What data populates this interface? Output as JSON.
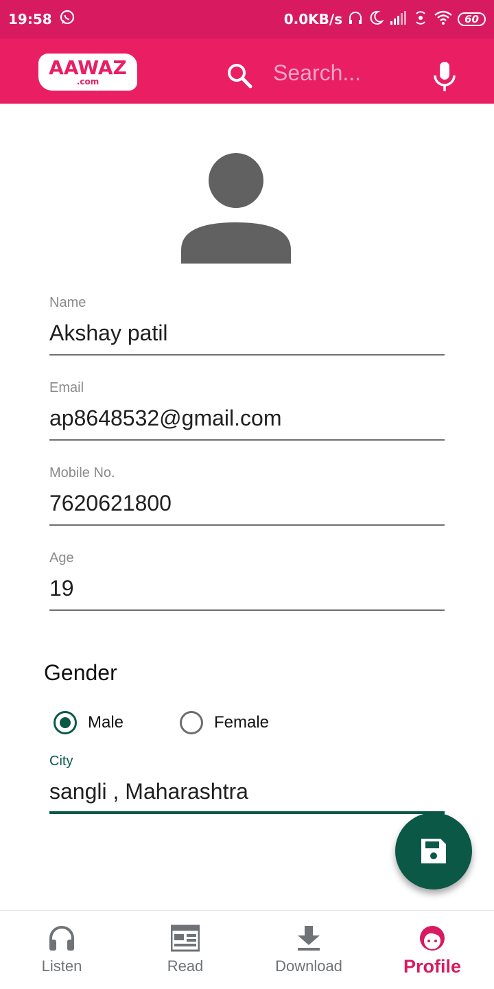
{
  "status_bar": {
    "time": "19:58",
    "net_speed": "0.0KB/s",
    "battery": "60"
  },
  "app_bar": {
    "logo_main": "AAWAZ",
    "logo_sub": ".com",
    "search_placeholder": "Search..."
  },
  "profile": {
    "fields": [
      {
        "label": "Name",
        "value": "Akshay patil"
      },
      {
        "label": "Email",
        "value": "ap8648532@gmail.com"
      },
      {
        "label": "Mobile No.",
        "value": "7620621800"
      },
      {
        "label": "Age",
        "value": "19"
      }
    ],
    "gender_title": "Gender",
    "gender_options": [
      {
        "label": "Male",
        "checked": true
      },
      {
        "label": "Female",
        "checked": false
      }
    ],
    "city": {
      "label": "City",
      "value": "sangli , Maharashtra"
    }
  },
  "bottom_nav": {
    "items": [
      {
        "label": "Listen",
        "icon": "headphones-icon"
      },
      {
        "label": "Read",
        "icon": "newspaper-icon"
      },
      {
        "label": "Download",
        "icon": "download-icon"
      },
      {
        "label": "Profile",
        "icon": "profile-face-icon",
        "active": true
      }
    ]
  },
  "colors": {
    "status_bar": "#d81b60",
    "app_bar": "#e91e63",
    "accent": "#0b5847",
    "active_nav": "#d81b60"
  }
}
